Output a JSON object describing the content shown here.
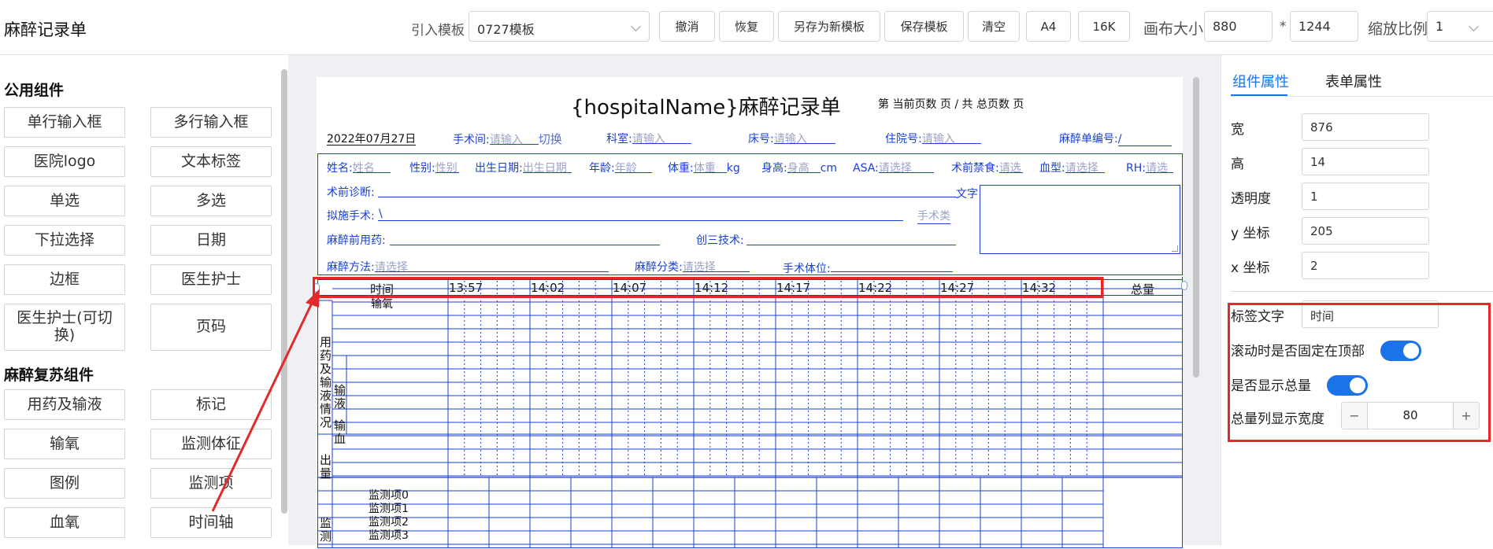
{
  "app": {
    "title": "麻醉记录单"
  },
  "toolbar": {
    "import_label": "引入模板",
    "template_value": "0727模板",
    "buttons": [
      "撤消",
      "恢复",
      "另存为新模板",
      "保存模板",
      "清空",
      "A4",
      "16K"
    ],
    "canvas_size_label": "画布大小",
    "canvas_width": "880",
    "times": "*",
    "canvas_height": "1244",
    "zoom_label": "缩放比例",
    "zoom_value": "1"
  },
  "sidebar": {
    "section1": "公用组件",
    "common": [
      "单行输入框",
      "多行输入框",
      "医院logo",
      "文本标签",
      "单选",
      "多选",
      "下拉选择",
      "日期",
      "边框",
      "医生护士",
      "医生护士(可切换)",
      "页码"
    ],
    "section2": "麻醉复苏组件",
    "anesthesia": [
      "用药及输液",
      "标记",
      "输氧",
      "监测体征",
      "图例",
      "监测项",
      "血氧",
      "时间轴"
    ]
  },
  "doc": {
    "title": "{hospitalName}麻醉记录单",
    "page_info": "第 当前页数 页 / 共 总页数 页",
    "date": "2022年07月27日",
    "header_fields": {
      "op_room_label": "手术间:",
      "op_room_ph": "请输入",
      "switch": "切换",
      "dept_label": "科室:",
      "dept_ph": "请输入",
      "bed_label": "床号:",
      "bed_ph": "请输入",
      "admission_label": "住院号:",
      "admission_ph": "请输入",
      "record_no_label": "麻醉单编号:",
      "record_no_val": "/"
    },
    "info": {
      "name_label": "姓名:",
      "name_ph": "姓名",
      "sex_label": "性别:",
      "sex_ph": "性别",
      "birth_label": "出生日期:",
      "birth_ph": "出生日期",
      "age_label": "年龄:",
      "age_ph": "年龄",
      "weight_label": "体重:",
      "weight_ph": "体重",
      "weight_unit": "kg",
      "height_label": "身高:",
      "height_ph": "身高",
      "height_unit": "cm",
      "asa_label": "ASA:",
      "asa_ph": "请选择",
      "fasting_label": "术前禁食:",
      "fasting_ph": "请选",
      "blood_label": "血型:",
      "blood_ph": "请选择",
      "rh_label": "RH:",
      "rh_ph": "请选",
      "diag_label": "术前诊断:",
      "text_label": "文字",
      "surgery_label": "拟施手术:",
      "surgery_val": "\\",
      "surgery_type": "手术类",
      "premed_label": "麻醉前用药:",
      "invasive_label": "创三技术:",
      "method_label": "麻醉方法:",
      "method_ph": "请选择",
      "class_label": "麻醉分类:",
      "class_ph": "请选择",
      "position_label": "手术体位:"
    },
    "timeline": {
      "label": "时间",
      "times": [
        "13:57",
        "14:02",
        "14:07",
        "14:12",
        "14:17",
        "14:22",
        "14:27",
        "14:32"
      ],
      "total": "总量"
    },
    "rows": {
      "oxygen": "输氧",
      "med_group": "用药及输液情况",
      "infusion": "输液",
      "transfusion": "输血",
      "output": "出量",
      "monitor_group": "监测",
      "monitors": [
        "监测项0",
        "监测项1",
        "监测项2",
        "监测项3"
      ]
    }
  },
  "props": {
    "tabs": [
      "组件属性",
      "表单属性"
    ],
    "active_tab": "组件属性",
    "fields": [
      {
        "label": "宽",
        "value": "876"
      },
      {
        "label": "高",
        "value": "14"
      },
      {
        "label": "透明度",
        "value": "1"
      },
      {
        "label": "y 坐标",
        "value": "205"
      },
      {
        "label": "x 坐标",
        "value": "2"
      }
    ],
    "label_text_label": "标签文字",
    "label_text_value": "时间",
    "fixed_top_label": "滚动时是否固定在顶部",
    "fixed_top_on": true,
    "show_total_label": "是否显示总量",
    "show_total_on": true,
    "total_width_label": "总量列显示宽度",
    "total_width_value": "80",
    "minus": "−",
    "plus": "+"
  },
  "colors": {
    "accent": "#1a73e8",
    "doc_blue": "#1a3fd6",
    "highlight": "#e32a2a"
  }
}
